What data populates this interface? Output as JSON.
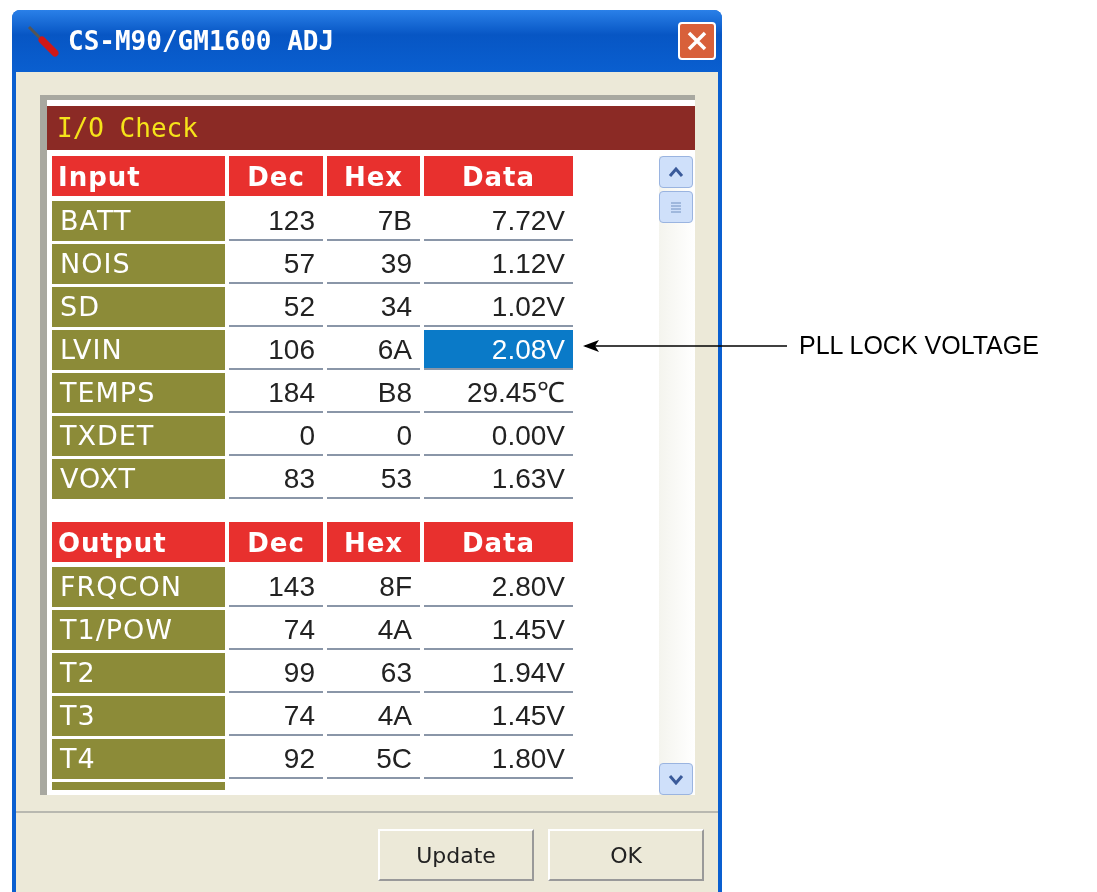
{
  "window": {
    "title": "CS-M90/GM1600 ADJ"
  },
  "panel": {
    "title": "I/O Check"
  },
  "sections": [
    {
      "columns": [
        "Input",
        "Dec",
        "Hex",
        "Data"
      ],
      "rows": [
        {
          "name": "BATT",
          "dec": "123",
          "hex": "7B",
          "data": "7.72V",
          "selected": false
        },
        {
          "name": "NOIS",
          "dec": "57",
          "hex": "39",
          "data": "1.12V",
          "selected": false
        },
        {
          "name": "SD",
          "dec": "52",
          "hex": "34",
          "data": "1.02V",
          "selected": false
        },
        {
          "name": "LVIN",
          "dec": "106",
          "hex": "6A",
          "data": "2.08V",
          "selected": true
        },
        {
          "name": "TEMPS",
          "dec": "184",
          "hex": "B8",
          "data": "29.45℃",
          "selected": false
        },
        {
          "name": "TXDET",
          "dec": "0",
          "hex": "0",
          "data": "0.00V",
          "selected": false
        },
        {
          "name": "VOXT",
          "dec": "83",
          "hex": "53",
          "data": "1.63V",
          "selected": false
        }
      ]
    },
    {
      "columns": [
        "Output",
        "Dec",
        "Hex",
        "Data"
      ],
      "rows": [
        {
          "name": "FRQCON",
          "dec": "143",
          "hex": "8F",
          "data": "2.80V",
          "selected": false
        },
        {
          "name": "T1/POW",
          "dec": "74",
          "hex": "4A",
          "data": "1.45V",
          "selected": false
        },
        {
          "name": "T2",
          "dec": "99",
          "hex": "63",
          "data": "1.94V",
          "selected": false
        },
        {
          "name": "T3",
          "dec": "74",
          "hex": "4A",
          "data": "1.45V",
          "selected": false
        },
        {
          "name": "T4",
          "dec": "92",
          "hex": "5C",
          "data": "1.80V",
          "selected": false
        }
      ]
    }
  ],
  "buttons": [
    "Update",
    "OK"
  ],
  "annotation": "PLL LOCK VOLTAGE"
}
